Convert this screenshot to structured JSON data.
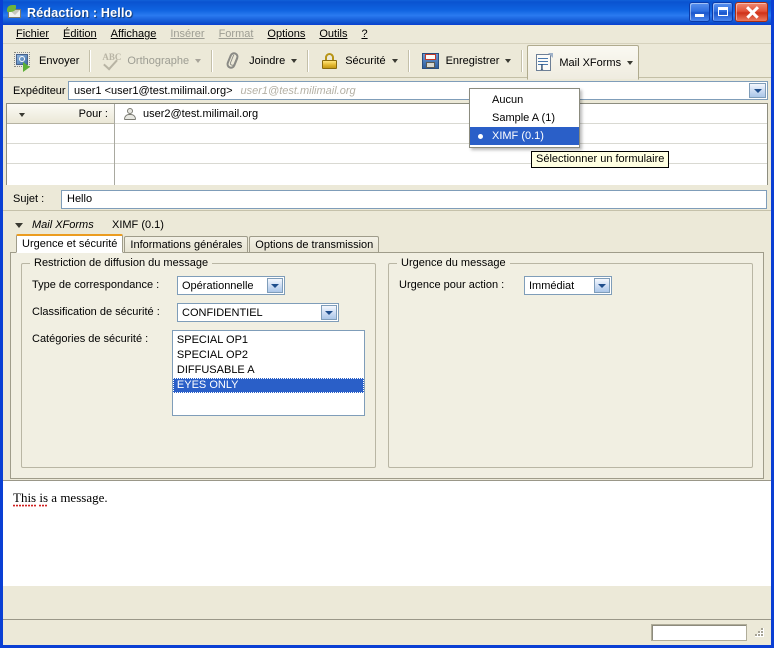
{
  "window": {
    "title": "Rédaction : Hello",
    "icon": "compose-mail-icon",
    "buttons": {
      "minimize": "Minimiser",
      "maximize": "Agrandir",
      "close": "Fermer"
    }
  },
  "menu": {
    "items": [
      {
        "label": "Fichier",
        "disabled": false
      },
      {
        "label": "Édition",
        "disabled": false
      },
      {
        "label": "Affichage",
        "disabled": false
      },
      {
        "label": "Insérer",
        "disabled": true
      },
      {
        "label": "Format",
        "disabled": true
      },
      {
        "label": "Options",
        "disabled": false
      },
      {
        "label": "Outils",
        "disabled": false
      },
      {
        "label": "?",
        "disabled": false
      }
    ]
  },
  "toolbar": {
    "send": "Envoyer",
    "spelling": "Orthographe",
    "attach": "Joindre",
    "security": "Sécurité",
    "save": "Enregistrer",
    "xforms": "Mail XForms"
  },
  "forms_menu": {
    "items": [
      {
        "label": "Aucun",
        "selected": false
      },
      {
        "label": "Sample A (1)",
        "selected": false
      },
      {
        "label": "XIMF (0.1)",
        "selected": true
      }
    ]
  },
  "tooltip": {
    "text": "Sélectionner un formulaire"
  },
  "headers": {
    "from_label": "Expéditeur :",
    "from_value": "user1 <user1@test.milimail.org>",
    "from_hint": "user1@test.milimail.org",
    "to_label": "Pour :",
    "to_value": "user2@test.milimail.org",
    "empty_rows": 3,
    "subject_label": "Sujet :",
    "subject_value": "Hello"
  },
  "xforms": {
    "panel_name": "Mail XForms",
    "panel_version": "XIMF (0.1)",
    "tabs": [
      {
        "label": "Urgence et sécurité",
        "active": true
      },
      {
        "label": "Informations générales",
        "active": false
      },
      {
        "label": "Options de transmission",
        "active": false
      }
    ],
    "left_group": {
      "title": "Restriction de diffusion du message",
      "correspondence_label": "Type de correspondance :",
      "correspondence_value": "Opérationnelle",
      "classification_label": "Classification de sécurité :",
      "classification_value": "CONFIDENTIEL",
      "categories_label": "Catégories de sécurité :",
      "categories": [
        {
          "label": "SPECIAL OP1",
          "selected": false
        },
        {
          "label": "SPECIAL OP2",
          "selected": false
        },
        {
          "label": "DIFFUSABLE A",
          "selected": false
        },
        {
          "label": "EYES ONLY",
          "selected": true
        }
      ]
    },
    "right_group": {
      "title": "Urgence du message",
      "urgency_label": "Urgence pour action :",
      "urgency_value": "Immédiat"
    }
  },
  "body": {
    "text_part1": "This",
    "text_part2": "is",
    "text_part3": "a message."
  },
  "colors": {
    "title_bar": "#0f63e0",
    "window_border": "#0a3fd4",
    "chrome": "#ece9d8",
    "selection": "#2a5fc8",
    "tooltip_bg": "#ffffe1",
    "active_tab_accent": "#eb9c20",
    "panel_bg": "#f1efe2"
  }
}
